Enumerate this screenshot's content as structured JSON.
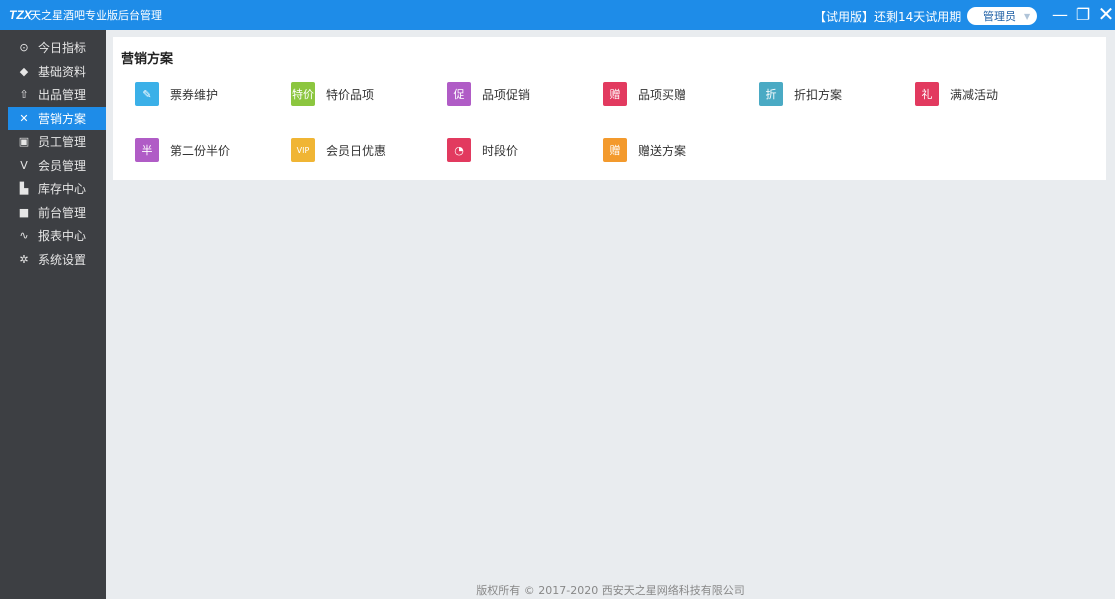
{
  "titlebar": {
    "logo": "TZX",
    "title": "天之星酒吧专业版后台管理",
    "trial": "【试用版】还剩14天试用期",
    "admin": "管理员",
    "minimize": "—",
    "restore": "❐",
    "close": "✕"
  },
  "sidebar": {
    "items": [
      {
        "label": "今日指标",
        "icon": "target-icon",
        "glyph": "⊙"
      },
      {
        "label": "基础资料",
        "icon": "layers-icon",
        "glyph": "◆"
      },
      {
        "label": "出品管理",
        "icon": "export-icon",
        "glyph": "⇧"
      },
      {
        "label": "营销方案",
        "icon": "tools-icon",
        "glyph": "✕"
      },
      {
        "label": "员工管理",
        "icon": "id-card-icon",
        "glyph": "▣"
      },
      {
        "label": "会员管理",
        "icon": "check-v-icon",
        "glyph": "V"
      },
      {
        "label": "库存中心",
        "icon": "warehouse-icon",
        "glyph": "▙"
      },
      {
        "label": "前台管理",
        "icon": "monitor-icon",
        "glyph": "■"
      },
      {
        "label": "报表中心",
        "icon": "chart-line-icon",
        "glyph": "∿"
      },
      {
        "label": "系统设置",
        "icon": "gear-icon",
        "glyph": "✲"
      }
    ],
    "active_index": 3
  },
  "panel": {
    "title": "营销方案",
    "tiles": [
      {
        "label": "票券维护",
        "icon": "ticket-edit-icon",
        "glyph": "✎",
        "color": "#3bb0e8"
      },
      {
        "label": "特价品项",
        "icon": "special-price-icon",
        "glyph": "特价",
        "color": "#8cc63f"
      },
      {
        "label": "品项促销",
        "icon": "promotion-icon",
        "glyph": "促",
        "color": "#b05cc6"
      },
      {
        "label": "品项买赠",
        "icon": "buy-gift-icon",
        "glyph": "赠",
        "color": "#e23a5f"
      },
      {
        "label": "折扣方案",
        "icon": "discount-icon",
        "glyph": "折",
        "color": "#4aaac4"
      },
      {
        "label": "满减活动",
        "icon": "gift-box-icon",
        "glyph": "礼",
        "color": "#e23a5f"
      },
      {
        "label": "第二份半价",
        "icon": "half-price-icon",
        "glyph": "半",
        "color": "#b05cc6"
      },
      {
        "label": "会员日优惠",
        "icon": "vip-calendar-icon",
        "glyph": "VIP",
        "color": "#f0b534"
      },
      {
        "label": "时段价",
        "icon": "clock-price-icon",
        "glyph": "◔",
        "color": "#e23a5f"
      },
      {
        "label": "赠送方案",
        "icon": "gift-plan-icon",
        "glyph": "赠",
        "color": "#f39a2d"
      }
    ]
  },
  "footer": "版权所有 © 2017-2020 西安天之星网络科技有限公司"
}
